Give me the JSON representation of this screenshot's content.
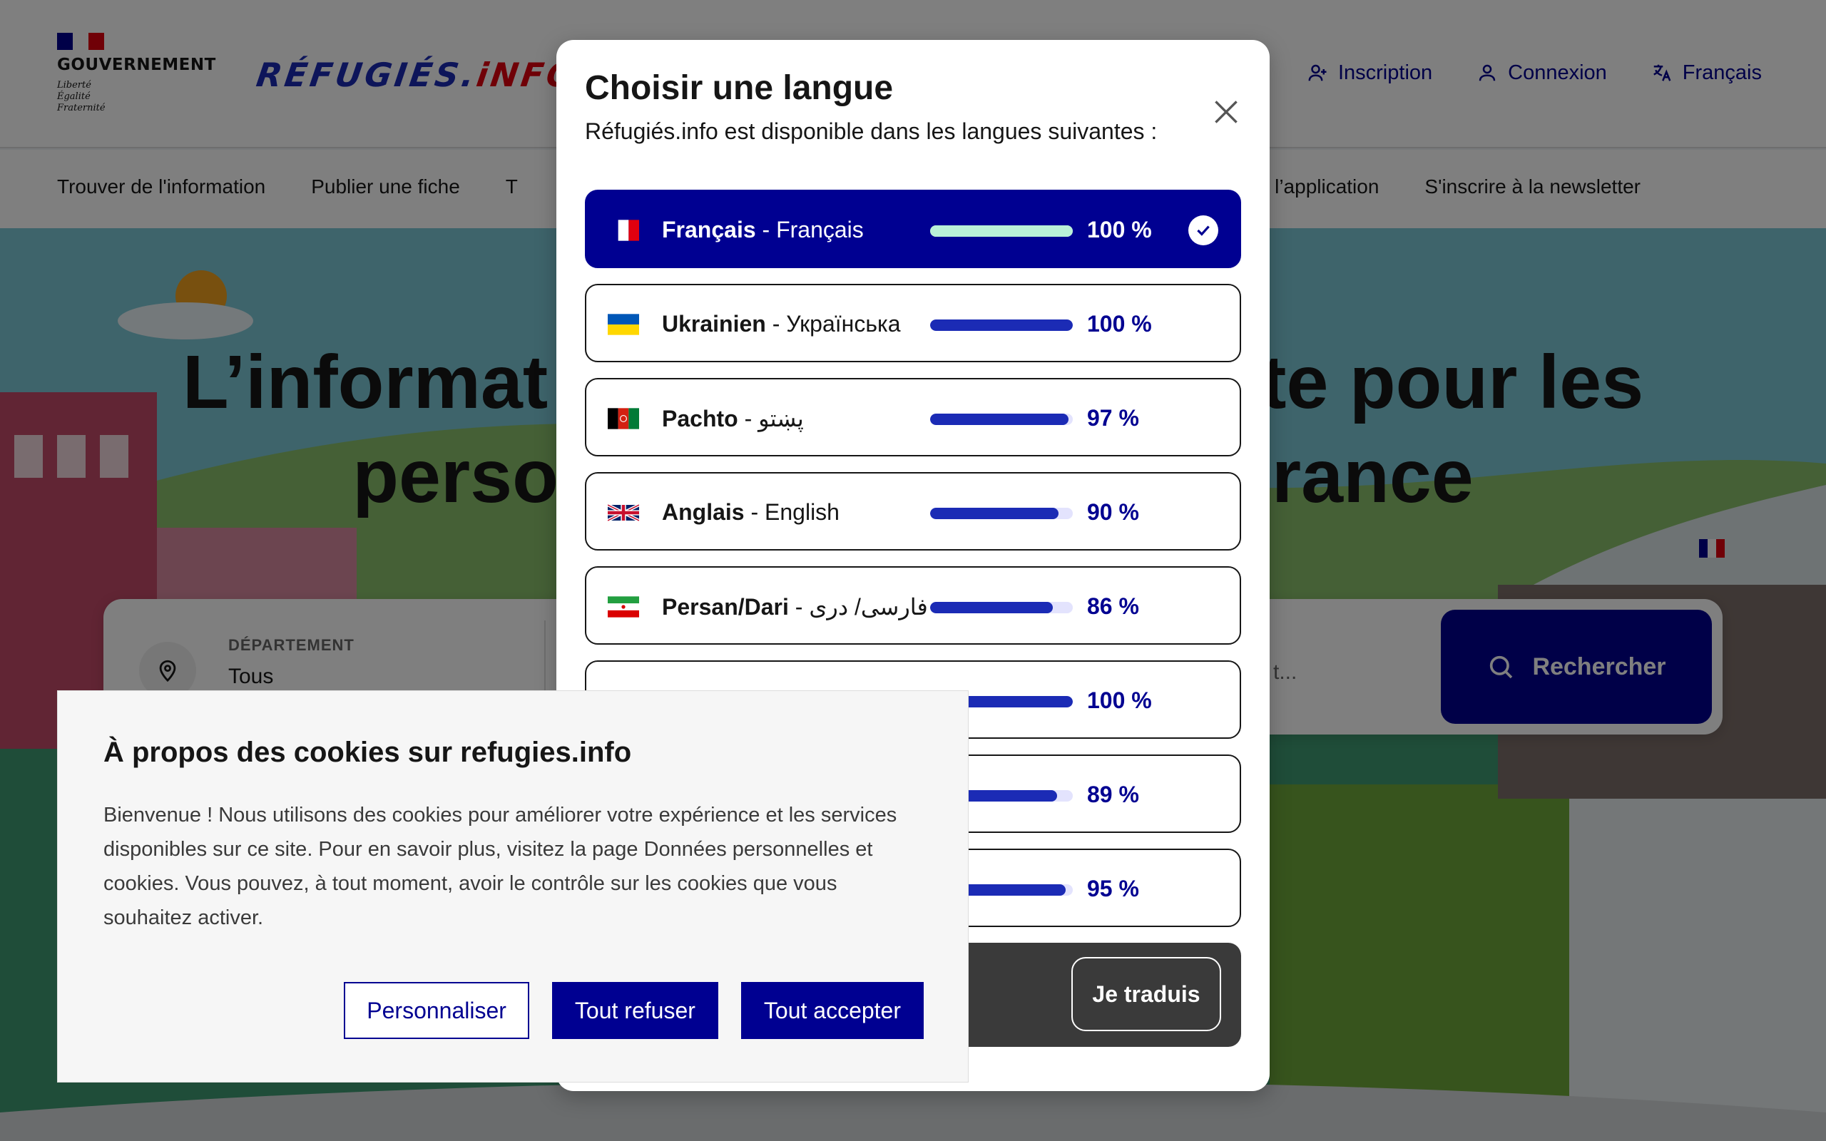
{
  "header": {
    "gov_name": "GOUVERNEMENT",
    "gov_motto": [
      "Liberté",
      "Égalité",
      "Fraternité"
    ],
    "brand_left": "RÉFUGIÉS.",
    "brand_right": "iNFO",
    "links": {
      "signup": "Inscription",
      "login": "Connexion",
      "language": "Français"
    }
  },
  "nav": {
    "item1": "Trouver de l'information",
    "item2": "Publier une fiche",
    "item3": "T",
    "item4": "r l’application",
    "item5": "S'inscrire à la newsletter"
  },
  "hero": {
    "line1_left": "L’informat",
    "line1_right": "te pour les",
    "line2_left": "perso",
    "line2_right": "rance"
  },
  "search": {
    "dept_label": "DÉPARTEMENT",
    "dept_value": "Tous",
    "right_partial": "t...",
    "button_label": "Rechercher"
  },
  "lang_modal": {
    "title": "Choisir une langue",
    "subtitle": "Réfugiés.info est disponible dans les langues suivantes :",
    "languages": [
      {
        "name": "Français",
        "native": "Français",
        "percent": 100,
        "percent_label": "100 %",
        "flag": "fr-flag",
        "selected": true
      },
      {
        "name": "Ukrainien",
        "native": "Українська",
        "percent": 100,
        "percent_label": "100 %",
        "flag": "ua-flag",
        "selected": false
      },
      {
        "name": "Pachto",
        "native": "پښتو",
        "percent": 97,
        "percent_label": "97 %",
        "flag": "af-flag",
        "selected": false
      },
      {
        "name": "Anglais",
        "native": "English",
        "percent": 90,
        "percent_label": "90 %",
        "flag": "gb-flag",
        "selected": false
      },
      {
        "name": "Persan/Dari",
        "native": "فارسی/ دری",
        "percent": 86,
        "percent_label": "86 %",
        "flag": "ir-flag",
        "selected": false
      },
      {
        "name": "",
        "native": "",
        "percent": 100,
        "percent_label": "100 %",
        "flag": "",
        "selected": false
      },
      {
        "name": "",
        "native": "",
        "percent": 89,
        "percent_label": "89 %",
        "flag": "",
        "selected": false
      },
      {
        "name": "",
        "native": "",
        "percent": 95,
        "percent_label": "95 %",
        "flag": "",
        "selected": false
      }
    ],
    "translate_button": "Je traduis"
  },
  "cookie": {
    "title": "À propos des cookies sur refugies.info",
    "text": "Bienvenue ! Nous utilisons des cookies pour améliorer votre expérience et les services disponibles sur ce site. Pour en savoir plus, visitez la page Données personnelles et cookies.  Vous pouvez, à tout moment, avoir le contrôle sur les cookies que vous souhaitez activer.",
    "btn_customize": "Personnaliser",
    "btn_refuse": "Tout refuser",
    "btn_accept": "Tout accepter"
  },
  "colors": {
    "accent": "#000091",
    "bar": "#1b2bb5",
    "bar_selected": "#b9f0d8",
    "brand_red": "#e1000f"
  }
}
